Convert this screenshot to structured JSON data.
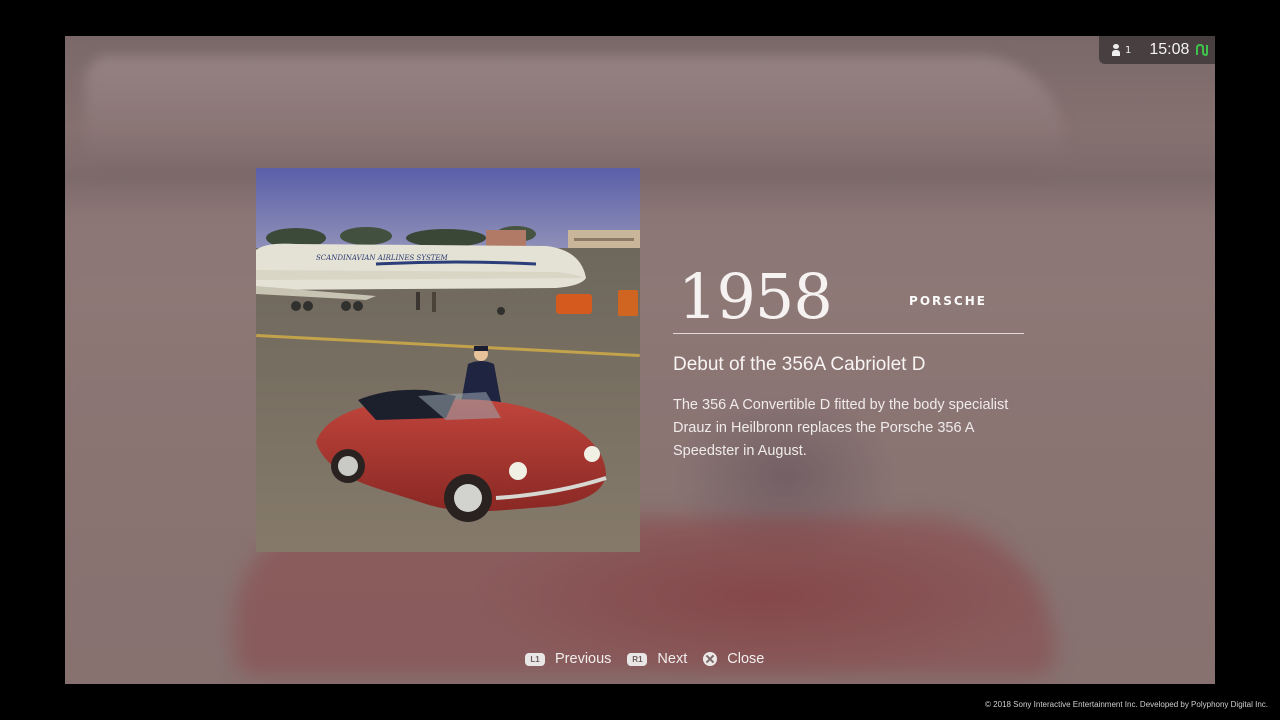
{
  "status": {
    "user_count": "1",
    "clock": "15:08",
    "user_icon": "user-icon",
    "network_icon": "network-icon"
  },
  "photo": {
    "airline_text": "SCANDINAVIAN AIRLINES SYSTEM"
  },
  "entry": {
    "year": "1958",
    "brand": "PORSCHE",
    "headline": "Debut of the 356A Cabriolet D",
    "body": "The 356 A Convertible D fitted by the body specialist Drauz in Heilbronn replaces the Porsche 356 A Speedster in August."
  },
  "controls": {
    "previous": {
      "button": "L1",
      "label": "Previous"
    },
    "next": {
      "button": "R1",
      "label": "Next"
    },
    "close": {
      "button_icon": "cross-button-icon",
      "label": "Close"
    }
  },
  "footer": {
    "copyright": "© 2018 Sony Interactive Entertainment Inc. Developed by Polyphony Digital Inc."
  },
  "colors": {
    "background_tint": "#8b7675",
    "frame": "#000000",
    "text": "#f2eeee",
    "network_green": "#3ec24a"
  }
}
